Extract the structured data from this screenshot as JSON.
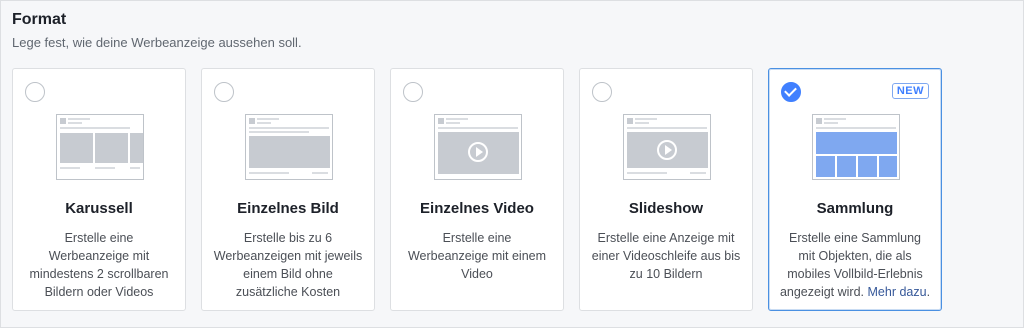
{
  "header": {
    "title": "Format",
    "subtitle": "Lege fest, wie deine Werbeanzeige aussehen soll."
  },
  "cards": [
    {
      "id": "karussell",
      "title": "Karussell",
      "desc": "Erstelle eine Werbeanzeige mit mindestens 2 scrollbaren Bildern oder Videos",
      "selected": false
    },
    {
      "id": "einzelnes-bild",
      "title": "Einzelnes Bild",
      "desc": "Erstelle bis zu 6 Werbeanzeigen mit jeweils einem Bild ohne zusätzliche Kosten",
      "selected": false
    },
    {
      "id": "einzelnes-video",
      "title": "Einzelnes Video",
      "desc": "Erstelle eine Werbeanzeige mit einem Video",
      "selected": false
    },
    {
      "id": "slideshow",
      "title": "Slideshow",
      "desc": "Erstelle eine Anzeige mit einer Videoschleife aus bis zu 10 Bildern",
      "selected": false
    },
    {
      "id": "sammlung",
      "title": "Sammlung",
      "desc": "Erstelle eine Sammlung mit Objekten, die als mobiles Vollbild-Erlebnis angezeigt wird.",
      "link": "Mehr dazu",
      "link_suffix": ".",
      "badge": "NEW",
      "selected": true
    }
  ],
  "colors": {
    "accent": "#4080ff",
    "selected_border": "#4a90e2",
    "link": "#365899"
  },
  "icons": {
    "selected": "checkmark-icon",
    "video": "play-icon"
  }
}
